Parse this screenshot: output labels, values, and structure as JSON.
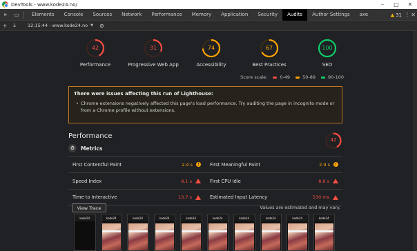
{
  "window": {
    "title": "DevTools - www.kode24.no/"
  },
  "tabs": [
    {
      "label": "Elements"
    },
    {
      "label": "Console"
    },
    {
      "label": "Sources"
    },
    {
      "label": "Network"
    },
    {
      "label": "Performance"
    },
    {
      "label": "Memory"
    },
    {
      "label": "Application"
    },
    {
      "label": "Security"
    },
    {
      "label": "Audits"
    },
    {
      "label": "Author Settings"
    },
    {
      "label": "axe"
    }
  ],
  "active_tab": "Audits",
  "warning_count": "31",
  "toolbar": {
    "report": "12:15:44 - www.kode24.no"
  },
  "categories": [
    {
      "label": "Performance",
      "score": "42",
      "value": 42,
      "color": "#ff4e42"
    },
    {
      "label": "Progressive Web App",
      "score": "31",
      "value": 31,
      "color": "#ff4e42"
    },
    {
      "label": "Accessibility",
      "score": "74",
      "value": 74,
      "color": "#ffa400"
    },
    {
      "label": "Best Practices",
      "score": "67",
      "value": 67,
      "color": "#ffa400"
    },
    {
      "label": "SEO",
      "score": "100",
      "value": 100,
      "color": "#0cce6b"
    }
  ],
  "score_scale": {
    "label": "Score scale:",
    "ranges": [
      {
        "label": "0-49",
        "color": "#ff4e42"
      },
      {
        "label": "50-89",
        "color": "#ffa400"
      },
      {
        "label": "90-100",
        "color": "#0cce6b"
      }
    ]
  },
  "warning_box": {
    "title": "There were issues affecting this run of Lighthouse:",
    "items": [
      "Chrome extensions negatively affected this page's load performance. Try auditing the page in incognito mode or from a Chrome profile without extensions."
    ]
  },
  "performance": {
    "title": "Performance",
    "score": "42",
    "value": 42,
    "metrics_title": "Metrics",
    "metrics": [
      {
        "label": "First Contentful Paint",
        "value": "2.4 s",
        "status": "average",
        "color": "#ffa400"
      },
      {
        "label": "First Meaningful Paint",
        "value": "2.9 s",
        "status": "average",
        "color": "#ffa400"
      },
      {
        "label": "Speed Index",
        "value": "8.1 s",
        "status": "fail",
        "color": "#ff4e42"
      },
      {
        "label": "First CPU Idle",
        "value": "8.6 s",
        "status": "fail",
        "color": "#ff4e42"
      },
      {
        "label": "Time to Interactive",
        "value": "13.7 s",
        "status": "fail",
        "color": "#ff4e42"
      },
      {
        "label": "Estimated Input Latency",
        "value": "530 ms",
        "status": "fail",
        "color": "#ff4e42"
      }
    ],
    "view_trace": "View Trace",
    "estimated_note": "Values are estimated and may vary."
  },
  "filmstrip": {
    "frames": [
      {
        "brand": "kode24"
      },
      {
        "brand": "kode24"
      },
      {
        "brand": "kode24"
      },
      {
        "brand": "kode24"
      },
      {
        "brand": "kode24"
      },
      {
        "brand": "kode24"
      },
      {
        "brand": "kode24"
      },
      {
        "brand": "kode24"
      },
      {
        "brand": "kode24"
      },
      {
        "brand": "kode24"
      }
    ]
  }
}
